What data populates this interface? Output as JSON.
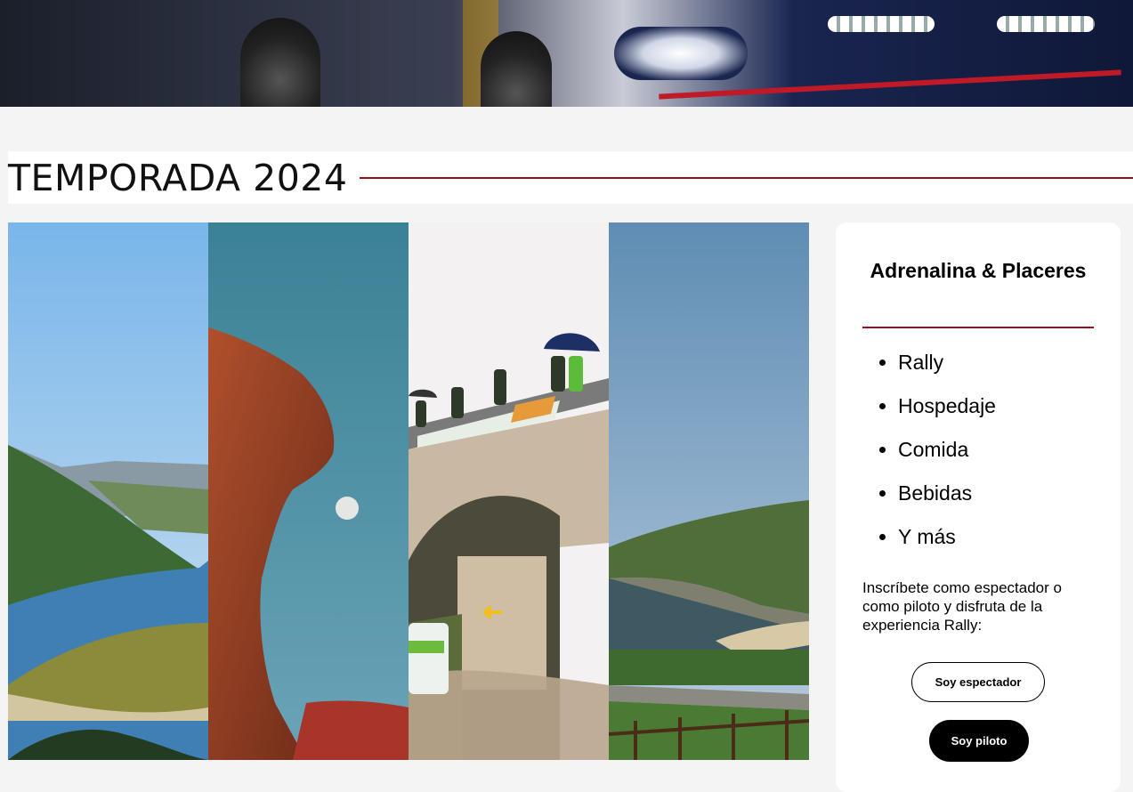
{
  "hero": {
    "image": "rally-car-banner"
  },
  "section": {
    "title": "TEMPORADA 2024"
  },
  "gallery": {
    "images": [
      {
        "name": "river-valley-photo"
      },
      {
        "name": "red-rock-moon-photo"
      },
      {
        "name": "rally-bridge-photo"
      },
      {
        "name": "coastal-bay-photo"
      }
    ]
  },
  "card": {
    "title": "Adrenalina & Placeres",
    "items": [
      "Rally",
      "Hospedaje",
      "Comida",
      "Bebidas",
      "Y más"
    ],
    "description": "Inscríbete como espectador o como piloto y disfruta de la experiencia Rally:",
    "buttons": {
      "spectator": "Soy espectador",
      "pilot": "Soy piloto"
    }
  },
  "colors": {
    "accent": "#9b1012",
    "background": "#f4f4f4",
    "card": "#ffffff"
  }
}
